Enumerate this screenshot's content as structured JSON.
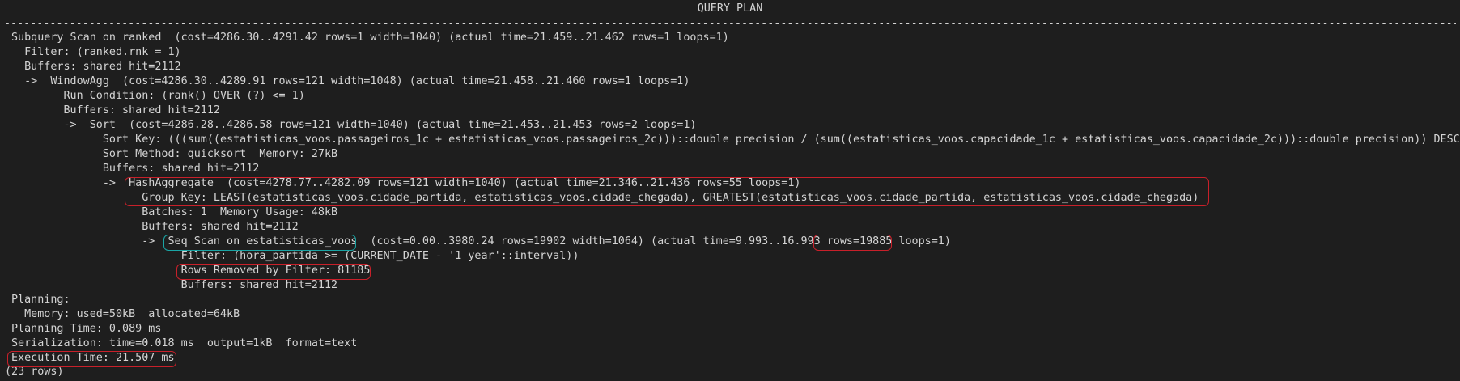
{
  "header": "QUERY PLAN",
  "separator_char": "-",
  "lines": [
    {
      "indent": "",
      "text": "Subquery Scan on ranked  (cost=4286.30..4291.42 rows=1 width=1040) (actual time=21.459..21.462 rows=1 loops=1)"
    },
    {
      "indent": "  ",
      "text": "Filter: (ranked.rnk = 1)"
    },
    {
      "indent": "  ",
      "text": "Buffers: shared hit=2112"
    },
    {
      "indent": "  ",
      "text": "->  WindowAgg  (cost=4286.30..4289.91 rows=121 width=1048) (actual time=21.458..21.460 rows=1 loops=1)"
    },
    {
      "indent": "        ",
      "text": "Run Condition: (rank() OVER (?) <= 1)"
    },
    {
      "indent": "        ",
      "text": "Buffers: shared hit=2112"
    },
    {
      "indent": "        ",
      "text": "->  Sort  (cost=4286.28..4286.58 rows=121 width=1040) (actual time=21.453..21.453 rows=2 loops=1)"
    },
    {
      "indent": "              ",
      "text": "Sort Key: (((sum((estatisticas_voos.passageiros_1c + estatisticas_voos.passageiros_2c)))::double precision / (sum((estatisticas_voos.capacidade_1c + estatisticas_voos.capacidade_2c)))::double precision)) DESC"
    },
    {
      "indent": "              ",
      "text": "Sort Method: quicksort  Memory: 27kB"
    },
    {
      "indent": "              ",
      "text": "Buffers: shared hit=2112"
    },
    {
      "indent": "              ",
      "text": "->  HashAggregate  (cost=4278.77..4282.09 rows=121 width=1040) (actual time=21.346..21.436 rows=55 loops=1)"
    },
    {
      "indent": "                    ",
      "text": "Group Key: LEAST(estatisticas_voos.cidade_partida, estatisticas_voos.cidade_chegada), GREATEST(estatisticas_voos.cidade_partida, estatisticas_voos.cidade_chegada)"
    },
    {
      "indent": "                    ",
      "text": "Batches: 1  Memory Usage: 48kB"
    },
    {
      "indent": "                    ",
      "text": "Buffers: shared hit=2112"
    },
    {
      "indent": "                    ",
      "text": "->  Seq Scan on estatisticas_voos  (cost=0.00..3980.24 rows=19902 width=1064) (actual time=9.993..16.993 rows=19885 loops=1)"
    },
    {
      "indent": "                          ",
      "text": "Filter: (hora_partida >= (CURRENT_DATE - '1 year'::interval))"
    },
    {
      "indent": "                          ",
      "text": "Rows Removed by Filter: 81185"
    },
    {
      "indent": "                          ",
      "text": "Buffers: shared hit=2112"
    },
    {
      "indent": "",
      "text": "Planning:"
    },
    {
      "indent": "  ",
      "text": "Memory: used=50kB  allocated=64kB"
    },
    {
      "indent": "",
      "text": "Planning Time: 0.089 ms"
    },
    {
      "indent": "",
      "text": "Serialization: time=0.018 ms  output=1kB  format=text"
    },
    {
      "indent": "",
      "text": "Execution Time: 21.507 ms"
    }
  ],
  "footer": "(23 rows)",
  "colors": {
    "background": "#1e1e1e",
    "text": "#d4d4d4",
    "highlight_red": "#c8202a",
    "highlight_teal": "#1aa5a5"
  }
}
